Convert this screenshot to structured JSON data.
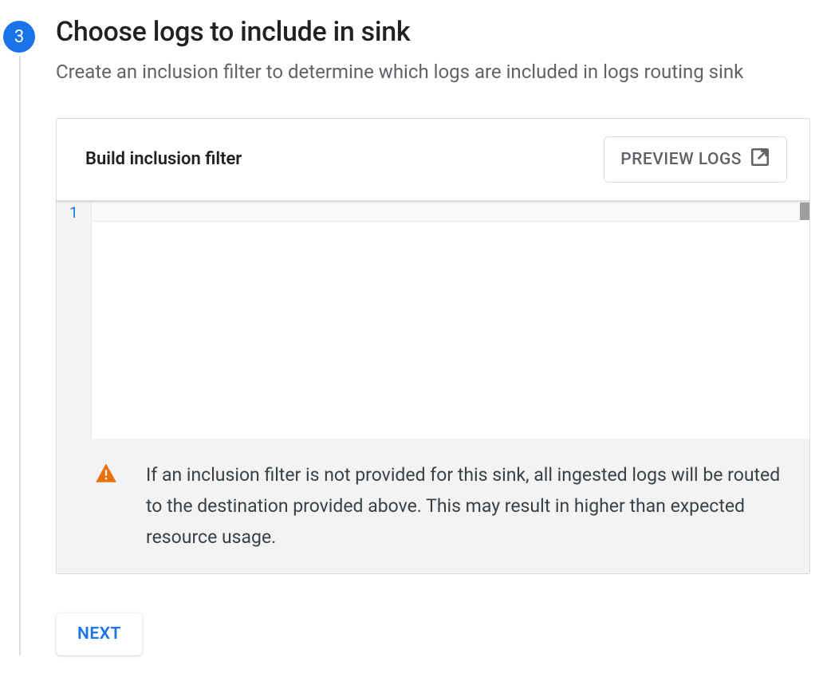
{
  "step": {
    "number": "3",
    "title": "Choose logs to include in sink",
    "description": "Create an inclusion filter to determine which logs are included in logs routing sink"
  },
  "filter": {
    "header_title": "Build inclusion filter",
    "preview_button_label": "PREVIEW LOGS",
    "editor_value": "",
    "line_number": "1"
  },
  "warning": {
    "text": "If an inclusion filter is not provided for this sink, all ingested logs will be routed to the destination provided above. This may result in higher than expected resource usage."
  },
  "actions": {
    "next_label": "NEXT"
  }
}
